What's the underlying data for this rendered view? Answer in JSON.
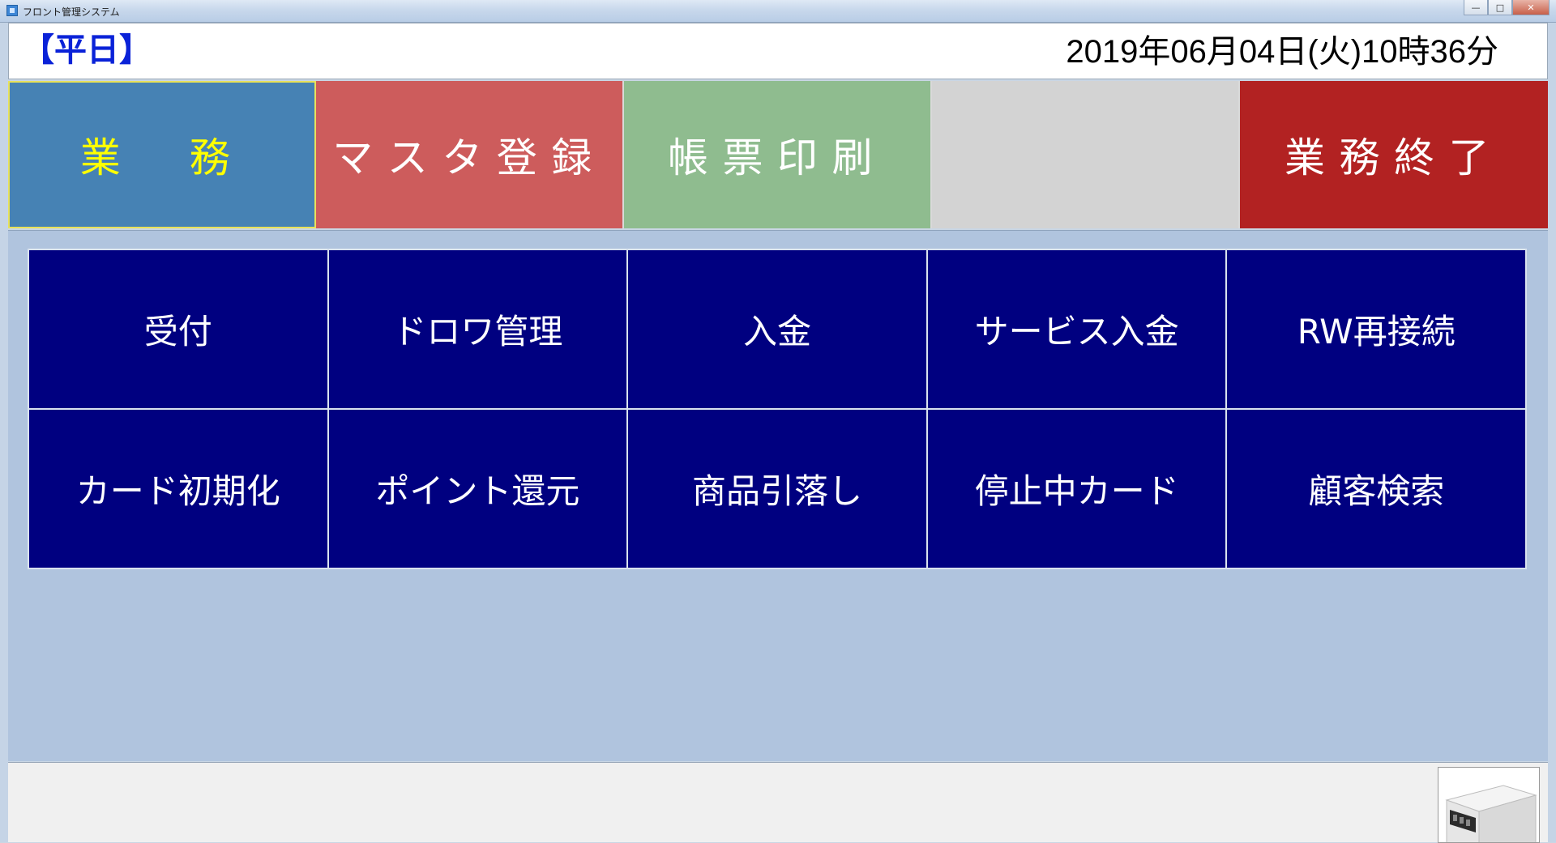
{
  "window": {
    "title": "フロント管理システム",
    "minimize_icon": "minimize-icon",
    "maximize_icon": "maximize-icon",
    "close_icon": "close-icon",
    "minimize_label": "—",
    "maximize_label": "□",
    "close_label": "✕"
  },
  "header": {
    "day_type": "【平日】",
    "datetime": "2019年06月04日(火)10時36分"
  },
  "tabs": [
    {
      "label": "業　務"
    },
    {
      "label": "マスタ登録"
    },
    {
      "label": "帳票印刷"
    },
    {
      "label": ""
    },
    {
      "label": "業務終了"
    }
  ],
  "functions": [
    {
      "label": "受付"
    },
    {
      "label": "ドロワ管理"
    },
    {
      "label": "入金"
    },
    {
      "label": "サービス入金"
    },
    {
      "label": "RW再接続"
    },
    {
      "label": "カード初期化"
    },
    {
      "label": "ポイント還元"
    },
    {
      "label": "商品引落し"
    },
    {
      "label": "停止中カード"
    },
    {
      "label": "顧客検索"
    }
  ],
  "statusbar": {
    "drawer_icon": "cash-drawer-icon"
  },
  "colors": {
    "tab_gyomu": "#4682b4",
    "tab_master": "#cd5c5c",
    "tab_print": "#8fbc8f",
    "tab_blank": "#d3d3d3",
    "tab_end": "#b22222",
    "function_button": "#000080",
    "panel": "#b0c4de",
    "day_label": "#0a22d8"
  }
}
